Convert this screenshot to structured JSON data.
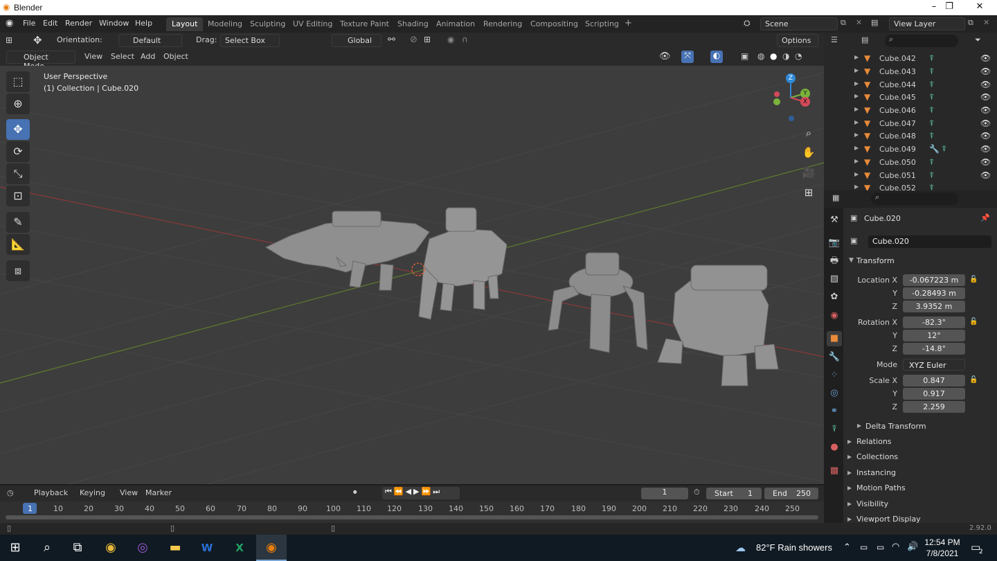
{
  "app": {
    "title": "Blender",
    "version": "2.92.0"
  },
  "window_buttons": {
    "minimize": "–",
    "maximize": "❐",
    "close": "✕"
  },
  "menu": [
    "File",
    "Edit",
    "Render",
    "Window",
    "Help"
  ],
  "workspaces": [
    "Layout",
    "Modeling",
    "Sculpting",
    "UV Editing",
    "Texture Paint",
    "Shading",
    "Animation",
    "Rendering",
    "Compositing",
    "Scripting"
  ],
  "workspace_add": "+",
  "scene": {
    "name": "Scene",
    "view_layer": "View Layer"
  },
  "tool_header": {
    "orientation_label": "Orientation:",
    "orientation_value": "Default",
    "drag_label": "Drag:",
    "drag_value": "Select Box",
    "transform_orientation": "Global",
    "options": "Options"
  },
  "view_header": {
    "mode": "Object Mode",
    "items": [
      "View",
      "Select",
      "Add",
      "Object"
    ]
  },
  "viewport": {
    "perspective": "User Perspective",
    "collection": "(1) Collection | Cube.020",
    "axis_labels": {
      "x": "X",
      "y": "Y",
      "z": "Z"
    }
  },
  "outliner": {
    "rows": [
      "Cube.042",
      "Cube.043",
      "Cube.044",
      "Cube.045",
      "Cube.046",
      "Cube.047",
      "Cube.048",
      "Cube.049",
      "Cube.050",
      "Cube.051",
      "Cube.052"
    ]
  },
  "properties": {
    "object_name": "Cube.020",
    "datablock": "Cube.020",
    "transform_title": "Transform",
    "location_label": "Location X",
    "location": [
      "-0.067223 m",
      "-0.28493 m",
      "3.9352 m"
    ],
    "rotation_label": "Rotation X",
    "rotation": [
      "-82.3°",
      "12°",
      "-14.8°"
    ],
    "mode_label": "Mode",
    "mode_value": "XYZ Euler",
    "scale_label": "Scale X",
    "scale": [
      "0.847",
      "0.917",
      "2.259"
    ],
    "y_label": "Y",
    "z_label": "Z",
    "delta": "Delta Transform",
    "sections": [
      "Relations",
      "Collections",
      "Instancing",
      "Motion Paths",
      "Visibility",
      "Viewport Display"
    ]
  },
  "timeline": {
    "menus": [
      "Playback",
      "Keying",
      "View",
      "Marker"
    ],
    "current_frame": "1",
    "start_label": "Start",
    "start": "1",
    "end_label": "End",
    "end": "250",
    "ticks": [
      "1",
      "10",
      "20",
      "30",
      "40",
      "50",
      "60",
      "70",
      "80",
      "90",
      "100",
      "110",
      "120",
      "130",
      "140",
      "150",
      "160",
      "170",
      "180",
      "190",
      "200",
      "210",
      "220",
      "230",
      "240",
      "250"
    ]
  },
  "taskbar": {
    "weather": "82°F  Rain showers",
    "time": "12:54 PM",
    "date": "7/8/2021",
    "notifications": "2"
  }
}
